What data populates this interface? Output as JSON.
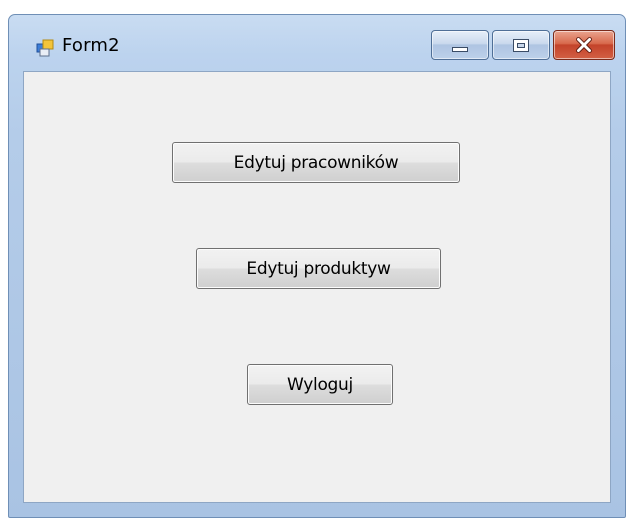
{
  "window": {
    "title": "Form2",
    "icon": "winforms-app-icon"
  },
  "caption_buttons": {
    "minimize": "minimize-icon",
    "maximize": "maximize-icon",
    "close": "close-icon"
  },
  "buttons": {
    "edit_employees": "Edytuj pracowników",
    "edit_products": "Edytuj produktyw",
    "logout": "Wyloguj"
  },
  "colors": {
    "frame": "#bcd3ee",
    "client_background": "#f0f0f0",
    "close_button": "#c3432a"
  }
}
